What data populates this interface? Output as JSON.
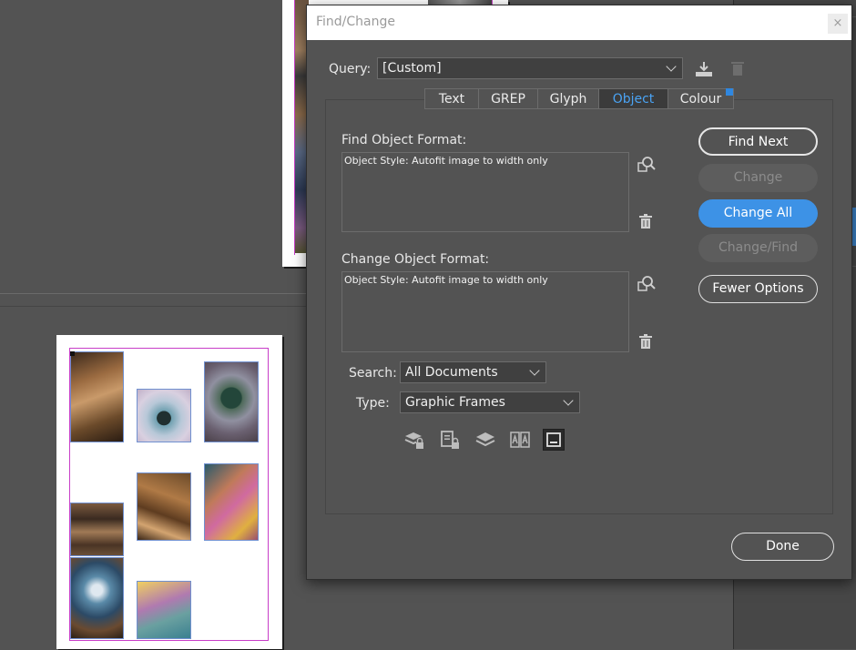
{
  "dialog": {
    "title": "Find/Change",
    "close_symbol": "×",
    "query_label": "Query:",
    "query_value": "[Custom]",
    "tabs": [
      {
        "label": "Text",
        "active": false
      },
      {
        "label": "GREP",
        "active": false
      },
      {
        "label": "Glyph",
        "active": false
      },
      {
        "label": "Object",
        "active": true
      },
      {
        "label": "Colour",
        "active": false
      }
    ],
    "find_label": "Find Object Format:",
    "find_value": "Object Style: Autofit image to width only",
    "change_label": "Change Object Format:",
    "change_value": "Object Style: Autofit image to width only",
    "search_label": "Search:",
    "search_value": "All Documents",
    "type_label": "Type:",
    "type_value": "Graphic Frames",
    "buttons": {
      "find_next": "Find Next",
      "change": "Change",
      "change_all": "Change All",
      "change_find": "Change/Find",
      "fewer_options": "Fewer Options",
      "done": "Done"
    },
    "option_icons": [
      "include-locked-layers-icon",
      "include-locked-objects-icon",
      "include-hidden-layers-icon",
      "include-master-pages-icon",
      "include-footnotes-icon"
    ]
  },
  "colors": {
    "accent": "#3d92e6",
    "active_tab_text": "#4aa3f3",
    "background": "#535353",
    "margin_guide": "#c83ec8"
  }
}
